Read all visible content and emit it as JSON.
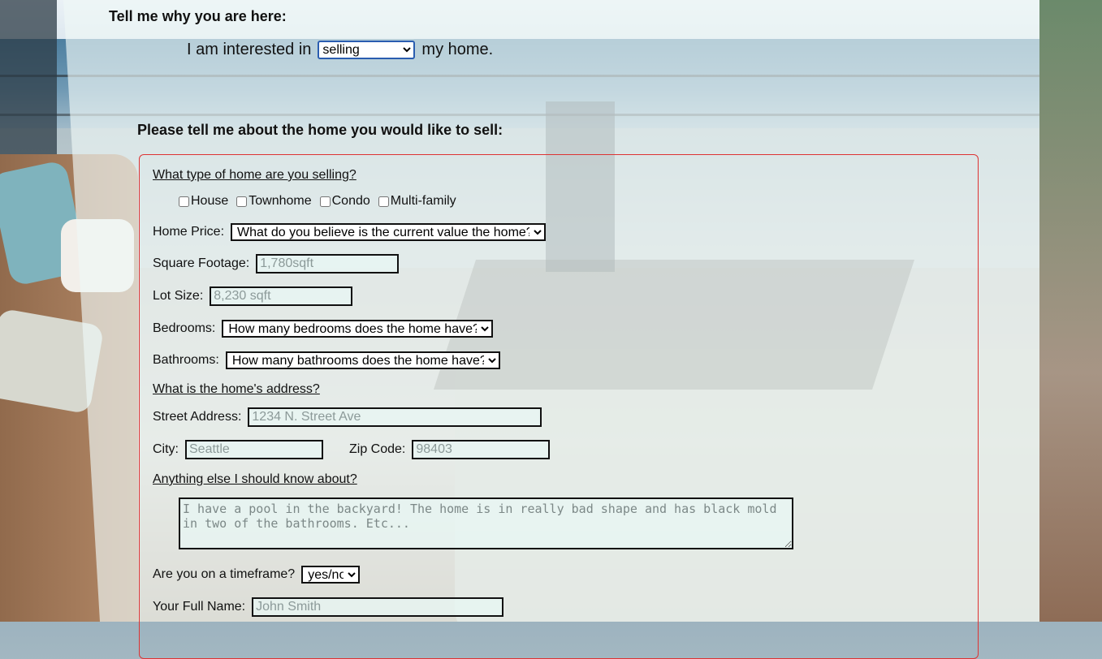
{
  "intro": {
    "heading": "Tell me why you are here:",
    "prefix": "I am interested in",
    "mode_selected": "selling",
    "suffix": "my home."
  },
  "section_heading": "Please tell me about the home you would like to sell:",
  "form": {
    "home_type": {
      "question": "What type of home are you selling?",
      "options": [
        "House",
        "Townhome",
        "Condo",
        "Multi-family"
      ]
    },
    "price": {
      "label": "Home Price:",
      "selected": "What do you believe is the current value the home?"
    },
    "sqft": {
      "label": "Square Footage:",
      "placeholder": "1,780sqft"
    },
    "lot": {
      "label": "Lot Size:",
      "placeholder": "8,230 sqft"
    },
    "bedrooms": {
      "label": "Bedrooms:",
      "selected": "How many bedrooms does the home have?"
    },
    "bathrooms": {
      "label": "Bathrooms:",
      "selected": "How many bathrooms does the home have?"
    },
    "address_question": "What is the home's address?",
    "street": {
      "label": "Street Address:",
      "placeholder": "1234 N. Street Ave"
    },
    "city": {
      "label": "City:",
      "placeholder": "Seattle"
    },
    "zip": {
      "label": "Zip Code:",
      "placeholder": "98403"
    },
    "notes_question": "Anything else I should know about?",
    "notes_placeholder": "I have a pool in the backyard! The home is in really bad shape and has black mold in two of the bathrooms. Etc...",
    "timeframe": {
      "label": "Are you on a timeframe?",
      "selected": "yes/no"
    },
    "name": {
      "label": "Your Full Name:",
      "placeholder": "John Smith"
    }
  }
}
